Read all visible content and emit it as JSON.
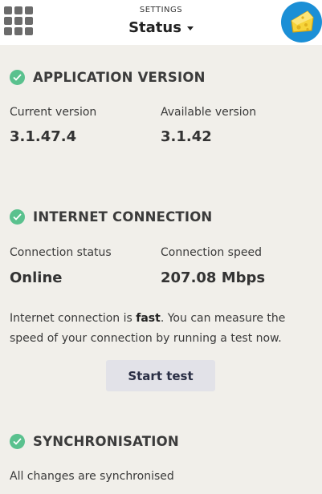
{
  "header": {
    "subtitle": "SETTINGS",
    "title": "Status",
    "apps_icon": "apps-grid-icon",
    "avatar_icon": "cheese-icon",
    "avatar_color": "#1b8fd6"
  },
  "colors": {
    "background": "#f1efea",
    "check": "#5ac18e",
    "button_bg": "#e2e2e8"
  },
  "app_version": {
    "heading": "APPLICATION VERSION",
    "current_label": "Current version",
    "current_value": "3.1.47.4",
    "available_label": "Available version",
    "available_value": "3.1.42"
  },
  "internet": {
    "heading": "INTERNET CONNECTION",
    "status_label": "Connection status",
    "status_value": "Online",
    "speed_label": "Connection speed",
    "speed_value": "207.08 Mbps",
    "message_prefix": "Internet connection is ",
    "message_bold": "fast",
    "message_suffix": ". You can measure the speed of your connection by running a test now.",
    "button_label": "Start test"
  },
  "sync": {
    "heading": "SYNCHRONISATION",
    "status": "All changes are synchronised"
  }
}
